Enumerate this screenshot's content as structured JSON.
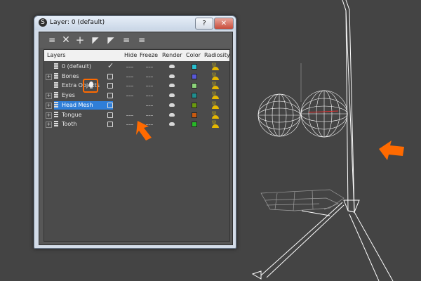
{
  "window": {
    "title": "Layer: 0 (default)",
    "help_label": "?",
    "close_label": "✕"
  },
  "toolbar": {
    "icons": [
      "new-layer-icon",
      "delete-layer-icon",
      "add-to-layer-icon",
      "select-in-layer-icon",
      "select-layer-icon",
      "hide-all-icon",
      "freeze-all-icon"
    ]
  },
  "columns": [
    "Layers",
    "Hide",
    "Freeze",
    "Render",
    "Color",
    "Radiosity"
  ],
  "layers": [
    {
      "name": "0 (default)",
      "expandable": false,
      "current": true,
      "color": "#28c0d0"
    },
    {
      "name": "Bones",
      "expandable": true,
      "current": false,
      "color": "#5858d8"
    },
    {
      "name": "Extra Objects",
      "expandable": false,
      "current": false,
      "color": "#8cd47a"
    },
    {
      "name": "Eyes",
      "expandable": true,
      "current": false,
      "color": "#1f8e8e"
    },
    {
      "name": "Head Mesh",
      "expandable": true,
      "current": false,
      "color": "#6a9a10",
      "selected": true
    },
    {
      "name": "Tongue",
      "expandable": true,
      "current": false,
      "color": "#c85a10"
    },
    {
      "name": "Tooth",
      "expandable": true,
      "current": false,
      "color": "#28b828"
    }
  ],
  "annotation_color": "#ff6a00"
}
